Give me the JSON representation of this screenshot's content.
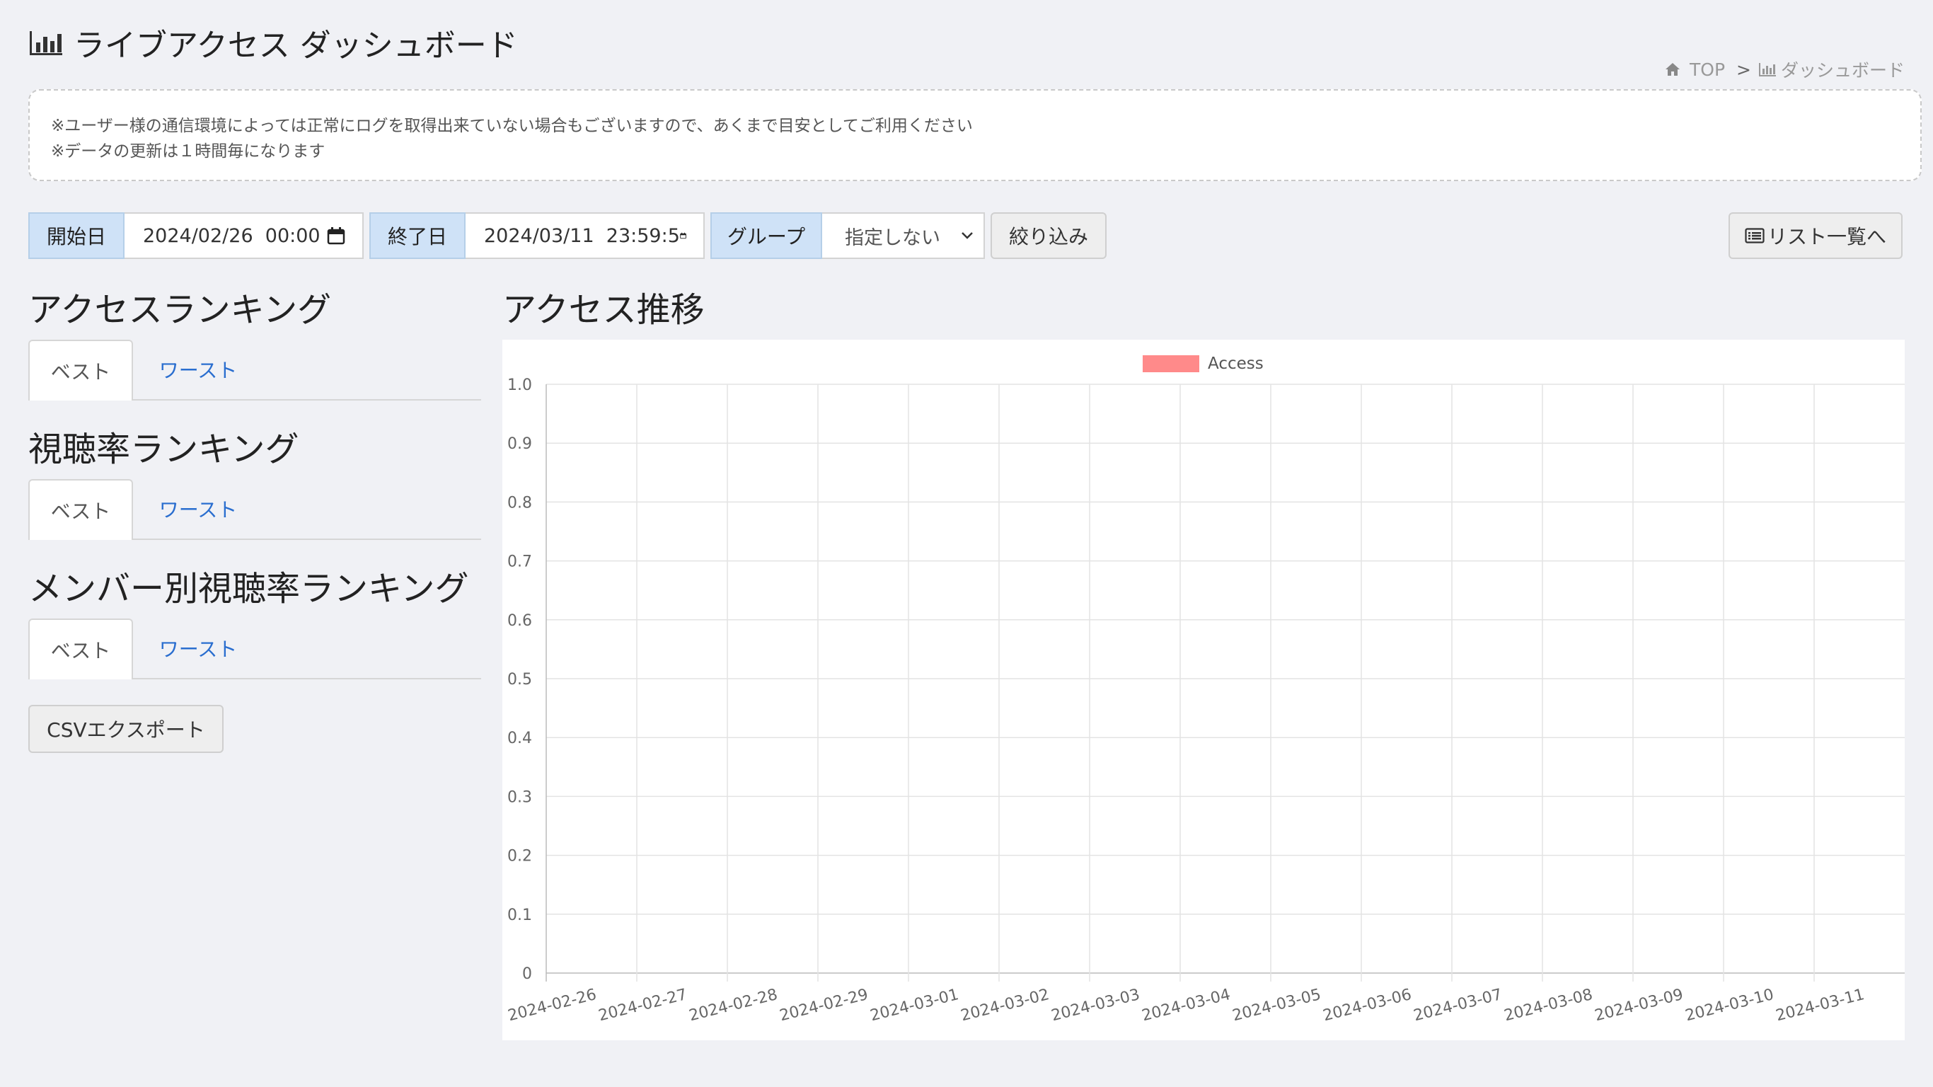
{
  "header": {
    "title": "ライブアクセス ダッシュボード",
    "breadcrumb": {
      "home": "TOP",
      "separator": ">",
      "current": "ダッシュボード"
    }
  },
  "notice": {
    "line1": "※ユーザー様の通信環境によっては正常にログを取得出来ていない場合もございますので、あくまで目安としてご利用ください",
    "line2": "※データの更新は１時間毎になります"
  },
  "filters": {
    "start_label": "開始日",
    "start_value": "2024/02/26  00:00",
    "end_label": "終了日",
    "end_value": "2024/03/11  23:59:5",
    "group_label": "グループ",
    "group_selected": "指定しない",
    "filter_button": "絞り込み",
    "list_button": "リスト一覧へ"
  },
  "rankings": [
    {
      "title": "アクセスランキング",
      "tab_best": "ベスト",
      "tab_worst": "ワースト"
    },
    {
      "title": "視聴率ランキング",
      "tab_best": "ベスト",
      "tab_worst": "ワースト"
    },
    {
      "title": "メンバー別視聴率ランキング",
      "tab_best": "ベスト",
      "tab_worst": "ワースト"
    }
  ],
  "csv_button": "CSVエクスポート",
  "chart_section_title": "アクセス推移",
  "colors": {
    "accent": "#cfe2f7",
    "series": "#ff8a8a",
    "link": "#2a6ecf"
  },
  "chart_data": {
    "type": "bar",
    "categories": [
      "2024-02-26",
      "2024-02-27",
      "2024-02-28",
      "2024-02-29",
      "2024-03-01",
      "2024-03-02",
      "2024-03-03",
      "2024-03-04",
      "2024-03-05",
      "2024-03-06",
      "2024-03-07",
      "2024-03-08",
      "2024-03-09",
      "2024-03-10",
      "2024-03-11"
    ],
    "series": [
      {
        "name": "Access",
        "values": [
          0,
          0,
          0,
          0,
          0,
          0,
          0,
          0,
          0,
          0,
          0,
          0,
          0,
          0,
          0
        ]
      }
    ],
    "ylim": [
      0,
      1.0
    ],
    "yticks": [
      0,
      0.1,
      0.2,
      0.3,
      0.4,
      0.5,
      0.6,
      0.7,
      0.8,
      0.9,
      1.0
    ],
    "ytick_labels": [
      "0",
      "0.1",
      "0.2",
      "0.3",
      "0.4",
      "0.5",
      "0.6",
      "0.7",
      "0.8",
      "0.9",
      "1.0"
    ],
    "legend": "top",
    "grid": true
  }
}
